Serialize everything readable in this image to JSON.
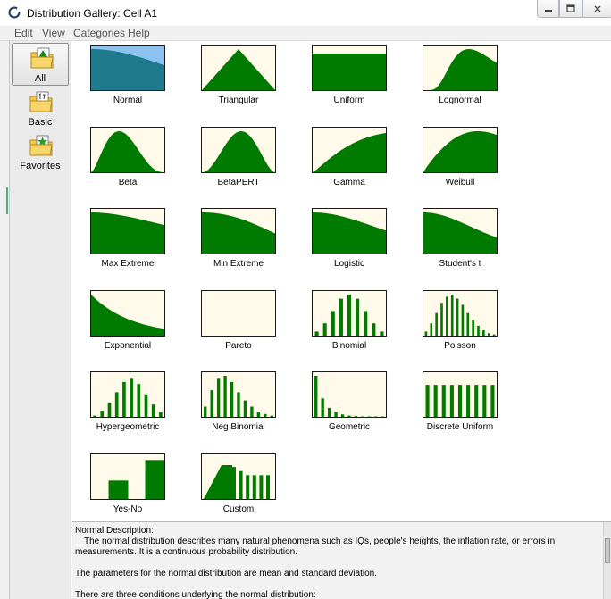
{
  "window": {
    "title": "Distribution Gallery: Cell A1",
    "icon": "crystal-ball-ring-icon",
    "controls": [
      "minimize-icon",
      "maximize-icon",
      "close-icon"
    ]
  },
  "menu": [
    "Edit",
    "View",
    "Categories",
    "Help"
  ],
  "categories": [
    {
      "label": "All",
      "icon": "folder-chart-icon",
      "selected": true
    },
    {
      "label": "Basic",
      "icon": "folder-number-icon",
      "selected": false
    },
    {
      "label": "Favorites",
      "icon": "folder-star-icon",
      "selected": false
    }
  ],
  "colors": {
    "curve_fill": "#007b00",
    "selected_fill": "#1e7a8c",
    "selected_bg": "#8ec3f0",
    "thumb_bg": "#fffaea"
  },
  "distributions": [
    {
      "label": "Normal",
      "shape": "normal",
      "selected": true
    },
    {
      "label": "Triangular",
      "shape": "triangular"
    },
    {
      "label": "Uniform",
      "shape": "uniform"
    },
    {
      "label": "Lognormal",
      "shape": "lognormal"
    },
    {
      "label": "Beta",
      "shape": "beta"
    },
    {
      "label": "BetaPERT",
      "shape": "betapert"
    },
    {
      "label": "Gamma",
      "shape": "gamma"
    },
    {
      "label": "Weibull",
      "shape": "weibull"
    },
    {
      "label": "Max Extreme",
      "shape": "maxextreme"
    },
    {
      "label": "Min Extreme",
      "shape": "minextreme"
    },
    {
      "label": "Logistic",
      "shape": "logistic"
    },
    {
      "label": "Student's t",
      "shape": "studentt"
    },
    {
      "label": "Exponential",
      "shape": "exponential"
    },
    {
      "label": "Pareto",
      "shape": "pareto"
    },
    {
      "label": "Binomial",
      "shape": "bars",
      "bars": [
        0.1,
        0.3,
        0.6,
        0.9,
        1.0,
        0.9,
        0.6,
        0.3,
        0.1
      ]
    },
    {
      "label": "Poisson",
      "shape": "bars",
      "bars": [
        0.1,
        0.3,
        0.55,
        0.8,
        0.95,
        1.0,
        0.9,
        0.75,
        0.55,
        0.38,
        0.24,
        0.13,
        0.06,
        0.03
      ]
    },
    {
      "label": "Hypergeometric",
      "shape": "bars",
      "bars": [
        0.03,
        0.15,
        0.35,
        0.6,
        0.85,
        0.95,
        0.8,
        0.55,
        0.3,
        0.13
      ]
    },
    {
      "label": "Neg Binomial",
      "shape": "bars",
      "bars": [
        0.25,
        0.65,
        0.95,
        1.0,
        0.85,
        0.6,
        0.4,
        0.25,
        0.13,
        0.07,
        0.03
      ]
    },
    {
      "label": "Geometric",
      "shape": "bars",
      "bars": [
        1.0,
        0.45,
        0.22,
        0.12,
        0.06,
        0.03,
        0.02,
        0.01,
        0.01,
        0.01,
        0.01
      ]
    },
    {
      "label": "Discrete Uniform",
      "shape": "bars",
      "bars": [
        0.78,
        0.78,
        0.78,
        0.78,
        0.78,
        0.78,
        0.78,
        0.78,
        0.78
      ]
    },
    {
      "label": "Yes-No",
      "shape": "yesno",
      "bars": [
        0.45,
        0.95
      ]
    },
    {
      "label": "Custom",
      "shape": "custom"
    }
  ],
  "description": {
    "title": "Normal Description:",
    "p1": "The normal distribution describes many natural phenomena such as IQs, people's heights, the inflation rate, or errors in measurements. It is a continuous probability distribution.",
    "p2": "The parameters for the normal distribution are mean and standard deviation.",
    "p3": "There are three conditions underlying the normal distribution:"
  }
}
